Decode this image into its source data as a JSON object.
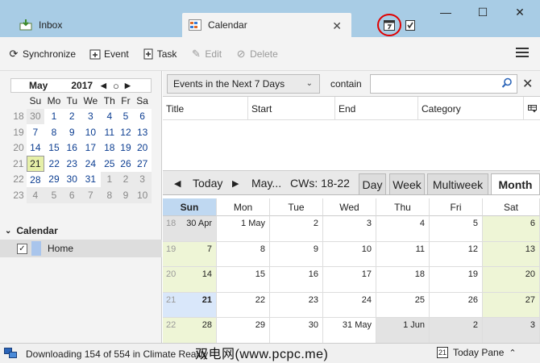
{
  "tabs": {
    "inbox": {
      "label": "Inbox"
    },
    "calendar": {
      "label": "Calendar"
    }
  },
  "window": {
    "minimize": "—",
    "maximize": "☐",
    "close": "✕"
  },
  "toolbar": {
    "synchronize": "Synchronize",
    "event": "Event",
    "task": "Task",
    "edit": "Edit",
    "delete": "Delete"
  },
  "minimonth": {
    "month": "May",
    "year": "2017",
    "weekdays": [
      "Su",
      "Mo",
      "Tu",
      "We",
      "Th",
      "Fr",
      "Sa"
    ],
    "weeks": [
      {
        "wk": "18",
        "days": [
          "30",
          "1",
          "2",
          "3",
          "4",
          "5",
          "6"
        ]
      },
      {
        "wk": "19",
        "days": [
          "7",
          "8",
          "9",
          "10",
          "11",
          "12",
          "13"
        ]
      },
      {
        "wk": "20",
        "days": [
          "14",
          "15",
          "16",
          "17",
          "18",
          "19",
          "20"
        ]
      },
      {
        "wk": "21",
        "days": [
          "21",
          "22",
          "23",
          "24",
          "25",
          "26",
          "27"
        ]
      },
      {
        "wk": "22",
        "days": [
          "28",
          "29",
          "30",
          "31",
          "1",
          "2",
          "3"
        ]
      },
      {
        "wk": "23",
        "days": [
          "4",
          "5",
          "6",
          "7",
          "8",
          "9",
          "10"
        ]
      }
    ]
  },
  "calendars": {
    "title": "Calendar",
    "items": [
      {
        "name": "Home",
        "checked": true,
        "color": "#a9c5ec"
      }
    ]
  },
  "filter": {
    "selected": "Events in the Next 7 Days",
    "contain_label": "contain",
    "search_value": "",
    "search_placeholder": ""
  },
  "tasklist": {
    "columns": [
      "Title",
      "Start",
      "End",
      "Category"
    ]
  },
  "nav": {
    "today": "Today",
    "period": "May...",
    "cws": "CWs: 18-22",
    "views": [
      "Day",
      "Week",
      "Multiweek",
      "Month"
    ],
    "active_view": "Month"
  },
  "month": {
    "day_headers": [
      "Sun",
      "Mon",
      "Tue",
      "Wed",
      "Thu",
      "Fri",
      "Sat"
    ],
    "weeks": [
      {
        "wk": "18",
        "days": [
          "30 Apr",
          "1 May",
          "2",
          "3",
          "4",
          "5",
          "6"
        ]
      },
      {
        "wk": "19",
        "days": [
          "7",
          "8",
          "9",
          "10",
          "11",
          "12",
          "13"
        ]
      },
      {
        "wk": "20",
        "days": [
          "14",
          "15",
          "16",
          "17",
          "18",
          "19",
          "20"
        ]
      },
      {
        "wk": "21",
        "days": [
          "21",
          "22",
          "23",
          "24",
          "25",
          "26",
          "27"
        ]
      },
      {
        "wk": "22",
        "days": [
          "28",
          "29",
          "30",
          "31 May",
          "1 Jun",
          "2",
          "3"
        ]
      }
    ]
  },
  "status": {
    "text": "Downloading 154 of 554 in Climate Reality",
    "today_pane": "Today Pane",
    "today_pane_date": "21"
  },
  "watermark": "双电网(www.pcpc.me)",
  "colors": {
    "tabbar": "#a8cce5",
    "accent": "#0b3d91",
    "weekend": "#eef5d6",
    "today_cell": "#d9e7fa",
    "highlight_circle": "#e00000"
  }
}
